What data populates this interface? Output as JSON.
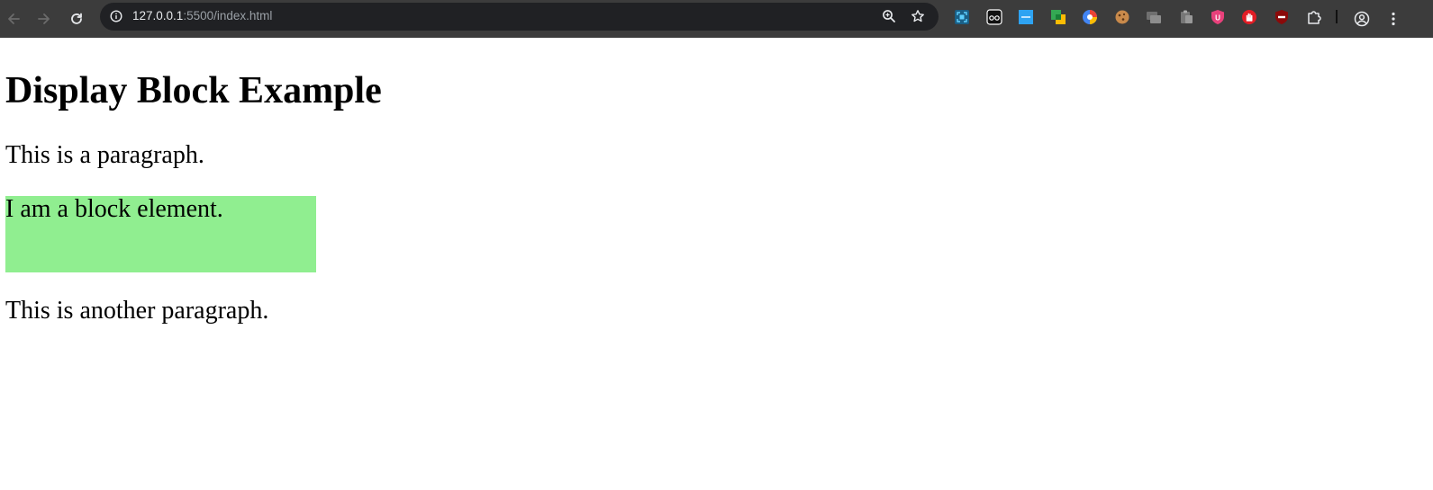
{
  "browser": {
    "url_host": "127.0.0.1",
    "url_rest": ":5500/index.html",
    "colors": {
      "toolbar": "#3c3c3c",
      "omnibox": "#202124"
    },
    "extensions": [
      "screen-capture-icon",
      "glasses-icon",
      "ms-tile-icon",
      "google-meet-icon",
      "color-wheel-icon",
      "cookie-icon",
      "tab-group-icon",
      "clipboard-icon",
      "ublock-shield-icon",
      "hand-stop-icon",
      "adblock-icon",
      "puzzle-extensions-icon"
    ]
  },
  "page": {
    "heading": "Display Block Example",
    "paragraph_1": "This is a paragraph.",
    "block_text": "I am a block element.",
    "paragraph_2": "This is another paragraph.",
    "block_color": "#90ee90"
  }
}
